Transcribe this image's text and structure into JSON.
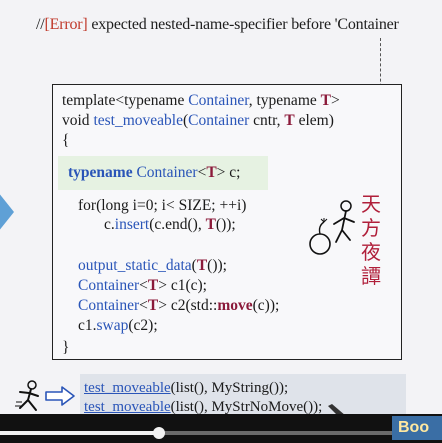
{
  "error_line": {
    "prefix": "//",
    "tag": "[Error]",
    "text": " expected nested-name-specifier before 'Container"
  },
  "code": {
    "l1_kw": "template<typename ",
    "l1_ty": "Container",
    "l1_mid": ", typename ",
    "l1_t": "T",
    "l1_end": ">",
    "l2_kw": "void ",
    "l2_fn": "test_moveable",
    "l2_open": "(",
    "l2_ty": "Container",
    "l2_mid": " cntr, ",
    "l2_t": "T",
    "l2_end": " elem)",
    "l3": "{",
    "l4_kw": "typename ",
    "l4_ty": "Container",
    "l4_lt": "<",
    "l4_t": "T",
    "l4_end": "> c;",
    "l5": "for(long i=0; i< SIZE; ++i)",
    "l6_pre": "c.",
    "l6_fn": "insert",
    "l6_mid": "(c.end(), ",
    "l6_t": "T",
    "l6_end": "());",
    "l7_fn": "output_static_data",
    "l7_open": "(",
    "l7_t": "T",
    "l7_end": "());",
    "l8_ty": "Container",
    "l8_lt": "<",
    "l8_t": "T",
    "l8_end": "> c1(c);",
    "l9_ty": "Container",
    "l9_lt": "<",
    "l9_t": "T",
    "l9_mid": "> c2(std::",
    "l9_mv": "move",
    "l9_end": "(c));",
    "l10_pre": "c1.",
    "l10_fn": "swap",
    "l10_end": "(c2);",
    "l11": "}"
  },
  "calligraphy": [
    "天",
    "方",
    "夜",
    "譚"
  ],
  "bottom": {
    "l1_fn": "test_moveable",
    "l1_rest": "(list(), MyString());",
    "l2_fn": "test_moveable",
    "l2_rest": "(list(), MyStrNoMove());"
  },
  "video": {
    "progress": 0.36,
    "watermark": "Boo"
  },
  "colors": {
    "type_blue": "#2a55b8",
    "template_param": "#8b1a3a",
    "error_red": "#c0392b",
    "highlight": "#e6f2e2"
  }
}
